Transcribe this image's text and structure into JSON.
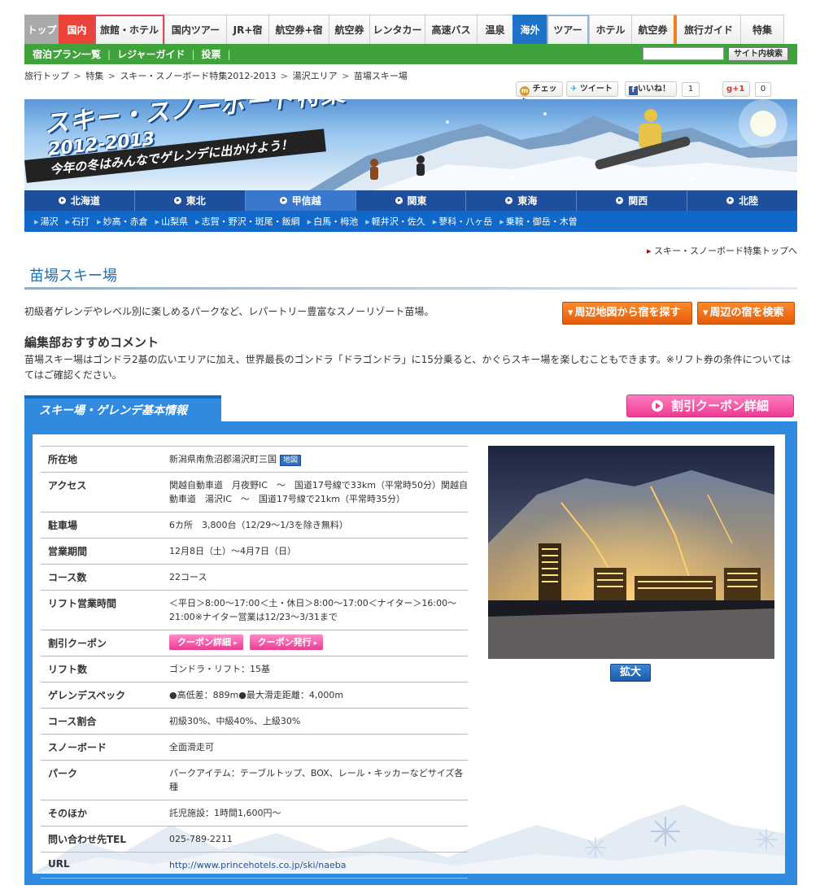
{
  "global_nav": {
    "tabs": [
      {
        "label": "トップ"
      },
      {
        "label": "国内"
      },
      {
        "label": "旅館・ホテル"
      },
      {
        "label": "国内ツアー"
      },
      {
        "label": "JR+宿"
      },
      {
        "label": "航空券+宿"
      },
      {
        "label": "航空券"
      },
      {
        "label": "レンタカー"
      },
      {
        "label": "高速バス"
      },
      {
        "label": "温泉"
      },
      {
        "label": "海外"
      },
      {
        "label": "ツアー"
      },
      {
        "label": "ホテル"
      },
      {
        "label": "航空券"
      },
      {
        "label": "旅行ガイド"
      },
      {
        "label": "特集"
      }
    ]
  },
  "sub_nav": {
    "links": [
      "宿泊プラン一覧",
      "レジャーガイド",
      "投票"
    ],
    "search_button": "サイト内検索",
    "search_value": ""
  },
  "breadcrumb": {
    "items": [
      "旅行トップ",
      "特集",
      "スキー・スノーボード特集2012-2013",
      "湯沢エリア",
      "苗場スキー場"
    ],
    "separator": ">"
  },
  "social": {
    "check": "チェック",
    "tweet": "ツイート",
    "like": "いいね！",
    "like_count": "1",
    "plus": "+1",
    "plus_count": "0"
  },
  "banner": {
    "title": "スキー・スノーボード特集",
    "year": "2012-2013",
    "subtitle": "今年の冬はみんなでゲレンデに出かけよう！"
  },
  "regions": {
    "tabs": [
      "北海道",
      "東北",
      "甲信越",
      "関東",
      "東海",
      "関西",
      "北陸"
    ],
    "active": "甲信越",
    "areas": [
      "湯沢",
      "石打",
      "妙高・赤倉",
      "山梨県",
      "志賀・野沢・斑尾・飯綱",
      "白馬・栂池",
      "軽井沢・佐久",
      "蓼科・八ヶ岳",
      "乗鞍・御岳・木曽"
    ]
  },
  "feature_top_link": "スキー・スノーボード特集トップへ",
  "page": {
    "title": "苗場スキー場",
    "intro": "初級者ゲレンデやレベル別に楽しめるパークなど、レパートリー豊富なスノーリゾート苗場。",
    "btn_map_search": "周辺地図から宿を探す",
    "btn_nearby_search": "周辺の宿を検索",
    "comment_heading": "編集部おすすめコメント",
    "comment_body": "苗場スキー場はゴンドラ2基の広いエリアに加え、世界最長のゴンドラ「ドラゴンドラ」に15分乗ると、かぐらスキー場を楽しむこともできます。※リフト券の条件については",
    "comment_body2": "てはご確認ください。"
  },
  "info": {
    "tab_label": "スキー場・ゲレンデ基本情報",
    "coupon_detail_big": "割引クーポン詳細",
    "map_badge": "地図",
    "coupon_detail": "クーポン詳細",
    "coupon_issue": "クーポン発行",
    "enlarge": "拡大",
    "rows": [
      {
        "label": "所在地",
        "value": "新潟県南魚沼郡湯沢町三国"
      },
      {
        "label": "アクセス",
        "value": "関越自動車道　月夜野IC　～　国道17号線で33km（平常時50分）関越自動車道　湯沢IC　～　国道17号線で21km（平常時35分）"
      },
      {
        "label": "駐車場",
        "value": "6カ所　3,800台（12/29～1/3を除き無料）"
      },
      {
        "label": "営業期間",
        "value": "12月8日（土）～4月7日（日）"
      },
      {
        "label": "コース数",
        "value": "22コース"
      },
      {
        "label": "リフト営業時間",
        "value": "＜平日＞8:00～17:00＜土・休日＞8:00～17:00＜ナイター＞16:00～21:00※ナイター営業は12/23～3/31まで"
      },
      {
        "label": "割引クーポン",
        "value": ""
      },
      {
        "label": "リフト数",
        "value": "ゴンドラ・リフト：15基"
      },
      {
        "label": "ゲレンデスペック",
        "value": "●高低差：889m●最大滑走距離：4,000m"
      },
      {
        "label": "コース割合",
        "value": "初級30%、中級40%、上級30%"
      },
      {
        "label": "スノーボード",
        "value": "全面滑走可"
      },
      {
        "label": "パーク",
        "value": "パークアイテム：テーブルトップ、BOX、レール・キッカーなどサイズ各種"
      },
      {
        "label": "そのほか",
        "value": "託児施設：1時間1,600円～"
      },
      {
        "label": "問い合わせ先TEL",
        "value": "025-789-2211"
      },
      {
        "label": "URL",
        "value": "http://www.princehotels.co.jp/ski/naeba"
      }
    ]
  }
}
